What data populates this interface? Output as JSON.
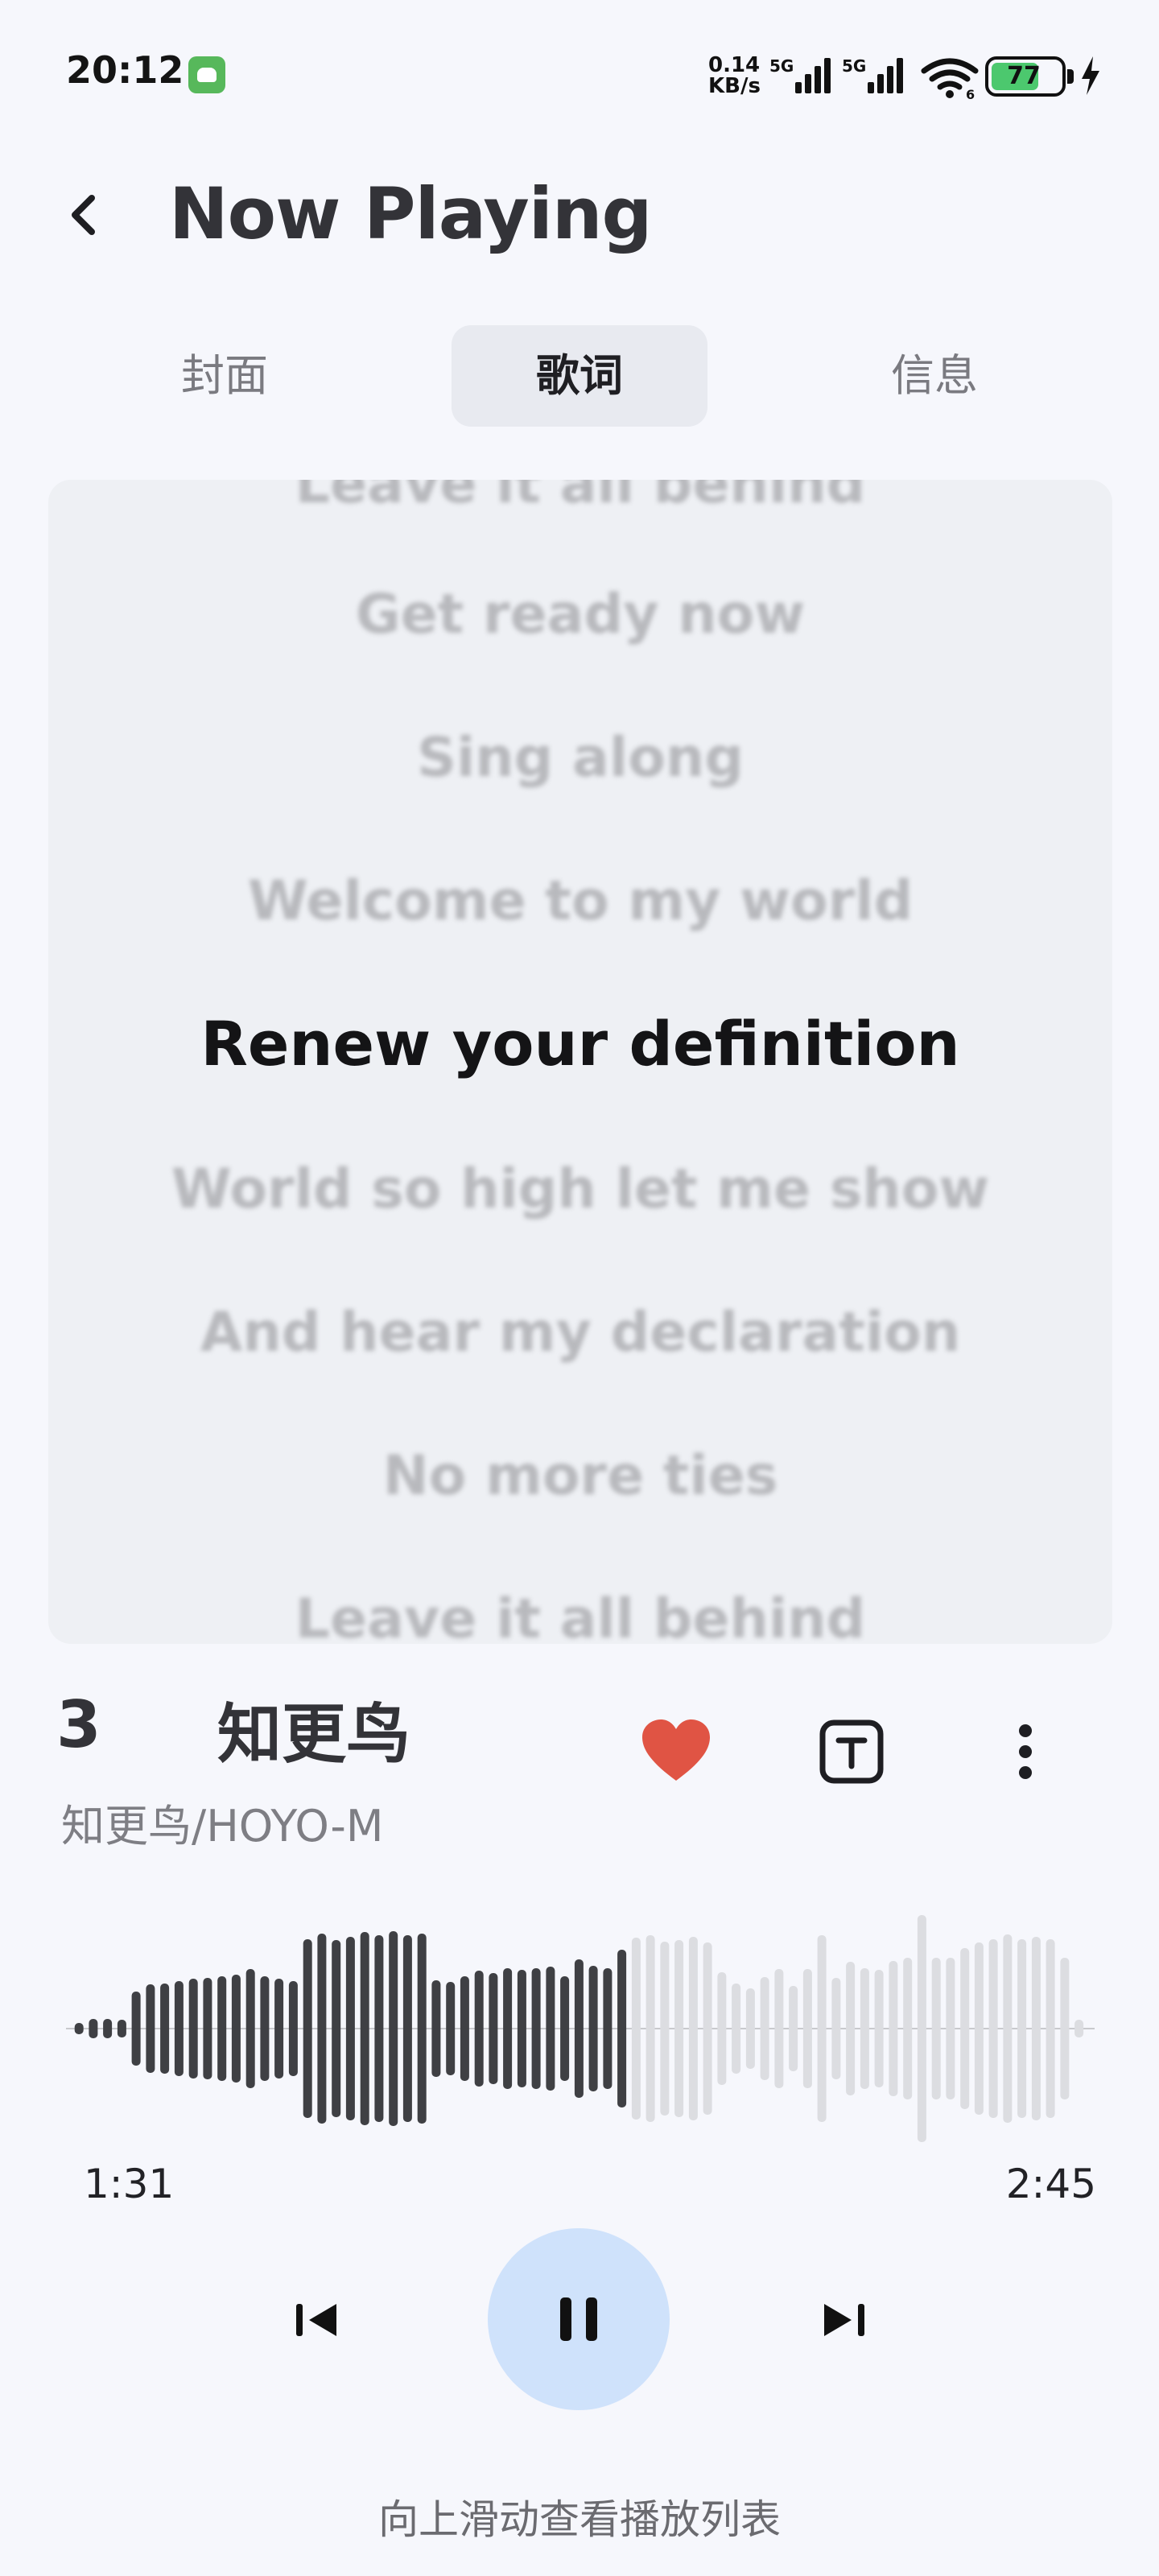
{
  "status_bar": {
    "time": "20:12",
    "net_speed_value": "0.14",
    "net_speed_unit": "KB/s",
    "signal_1_label": "5G",
    "signal_2_label": "5G",
    "wifi_label": "6",
    "battery": "77"
  },
  "header": {
    "title": "Now Playing",
    "back_icon": "chevron-left-icon"
  },
  "tabs": [
    {
      "label": "封面",
      "active": false
    },
    {
      "label": "歌词",
      "active": true
    },
    {
      "label": "信息",
      "active": false
    }
  ],
  "lyrics": {
    "lines": [
      "Leave it all behind",
      "Get ready now",
      "Sing along",
      "Welcome to my world",
      "Renew your definition",
      "World so high let me show",
      "And hear my declaration",
      "No more ties",
      "Leave it all behind"
    ],
    "current_index": 4
  },
  "song": {
    "track_number": "3",
    "title": "知更鸟",
    "artist": "知更鸟/HOYO-M",
    "favorite": true,
    "favorite_color": "#e05444"
  },
  "playback": {
    "elapsed": "1:31",
    "duration": "2:45",
    "progress": 0.55,
    "played_color": "#3f4044",
    "unplayed_color": "#dcdde1",
    "play_button_color": "#cfe2fb"
  },
  "footer": {
    "hint": "向上滑动查看播放列表"
  }
}
